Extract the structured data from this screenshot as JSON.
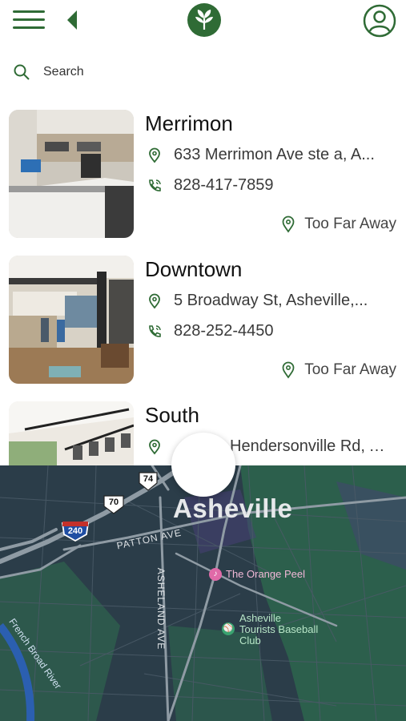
{
  "header": {
    "menu_icon": "hamburger-menu-icon",
    "back_icon": "back-arrow-icon",
    "logo_icon": "leaf-logo-icon",
    "profile_icon": "user-profile-icon"
  },
  "search": {
    "placeholder": "Search",
    "icon": "search-icon"
  },
  "locations": [
    {
      "name": "Merrimon",
      "address": "633 Merrimon Ave ste a, A...",
      "phone": "828-417-7859",
      "status": "Too Far Away"
    },
    {
      "name": "Downtown",
      "address": "5 Broadway St, Asheville,...",
      "phone": "828-252-4450",
      "status": "Too Far Away"
    },
    {
      "name": "South",
      "address": "Hendersonville Rd, A...",
      "phone": "",
      "status": ""
    }
  ],
  "map": {
    "city_label": "Asheville",
    "shields": [
      "74",
      "70",
      "240"
    ],
    "roads": [
      "PATTON AVE",
      "ASHELAND AVE"
    ],
    "river": "French Broad River",
    "pois": [
      "The Orange Peel",
      "Asheville Tourists Baseball Club"
    ]
  },
  "colors": {
    "brand_green": "#2f6b35",
    "map_bg": "#2b3e4a",
    "park_green": "#2e6b4e"
  }
}
